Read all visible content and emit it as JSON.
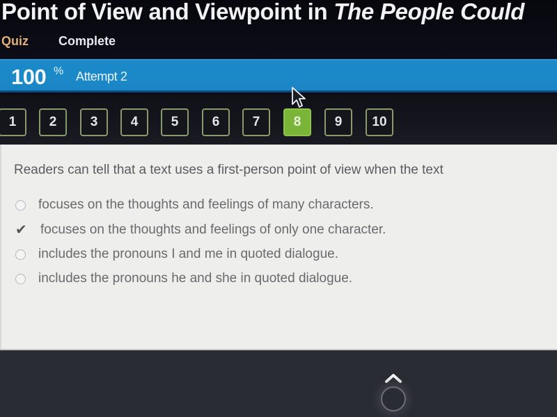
{
  "header": {
    "title_prefix": "Point of View and Viewpoint in ",
    "title_italic": "The People Could",
    "nav": {
      "quiz": "Quiz",
      "status": "Complete"
    }
  },
  "score": {
    "value": "100",
    "unit": "%",
    "attempt": "Attempt 2"
  },
  "question_nav": {
    "items": [
      "1",
      "2",
      "3",
      "4",
      "5",
      "6",
      "7",
      "8",
      "9",
      "10"
    ],
    "active": "8"
  },
  "question": {
    "prompt": "Readers can tell that a text uses a first-person point of view when the text",
    "options": [
      {
        "text": "focuses on the thoughts and feelings of many characters.",
        "selected": false
      },
      {
        "text": "focuses on the thoughts and feelings of only one character.",
        "selected": true
      },
      {
        "text": "includes the pronouns I and me in quoted dialogue.",
        "selected": false
      },
      {
        "text": "includes the pronouns he and she in quoted dialogue.",
        "selected": false
      }
    ]
  },
  "colors": {
    "score_bar": "#1b8ac8",
    "active_question": "#7ab53a",
    "quiz_label": "#e0b07a"
  },
  "icons": {
    "selected_option": "checkmark-icon",
    "unselected_option": "radio-icon",
    "footer": "chevron-up-icon"
  }
}
